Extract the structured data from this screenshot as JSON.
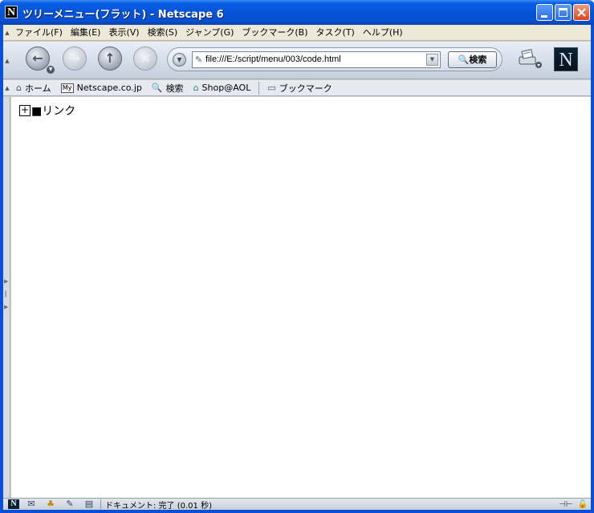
{
  "window": {
    "title": "ツリーメニュー(フラット) - Netscape 6",
    "app_icon_letter": "N"
  },
  "menubar": {
    "items": [
      {
        "label": "ファイル(F)"
      },
      {
        "label": "編集(E)"
      },
      {
        "label": "表示(V)"
      },
      {
        "label": "検索(S)"
      },
      {
        "label": "ジャンプ(G)"
      },
      {
        "label": "ブックマーク(B)"
      },
      {
        "label": "タスク(T)"
      },
      {
        "label": "ヘルプ(H)"
      }
    ]
  },
  "navbar": {
    "url": "file:///E:/script/menu/003/code.html",
    "search_label": "🔍検索",
    "logo_letter": "N",
    "icons": {
      "back": "back-arrow-icon",
      "forward": "forward-arrow-icon",
      "reload": "reload-icon",
      "stop": "stop-icon",
      "print": "print-icon"
    }
  },
  "personal_toolbar": {
    "items": [
      {
        "label": "ホーム",
        "icon": "home-icon"
      },
      {
        "label": "Netscape.co.jp",
        "icon": "my-netscape-icon",
        "badge": "My"
      },
      {
        "label": "検索",
        "icon": "search-icon"
      },
      {
        "label": "Shop@AOL",
        "icon": "shop-icon"
      },
      {
        "label": "ブックマーク",
        "icon": "folder-icon"
      }
    ]
  },
  "content": {
    "tree": [
      {
        "toggle": "+",
        "label": "■リンク"
      }
    ]
  },
  "statusbar": {
    "text": "ドキュメント: 完了 (0.01 秒)",
    "icons": [
      "navigator-icon",
      "mail-icon",
      "aim-icon",
      "composer-icon",
      "address-book-icon"
    ]
  },
  "colors": {
    "title_bar": "#0654d8",
    "close_button": "#d8471f",
    "toolbar_bg": "#c5cfdc",
    "menubar_bg": "#ece9d8"
  }
}
